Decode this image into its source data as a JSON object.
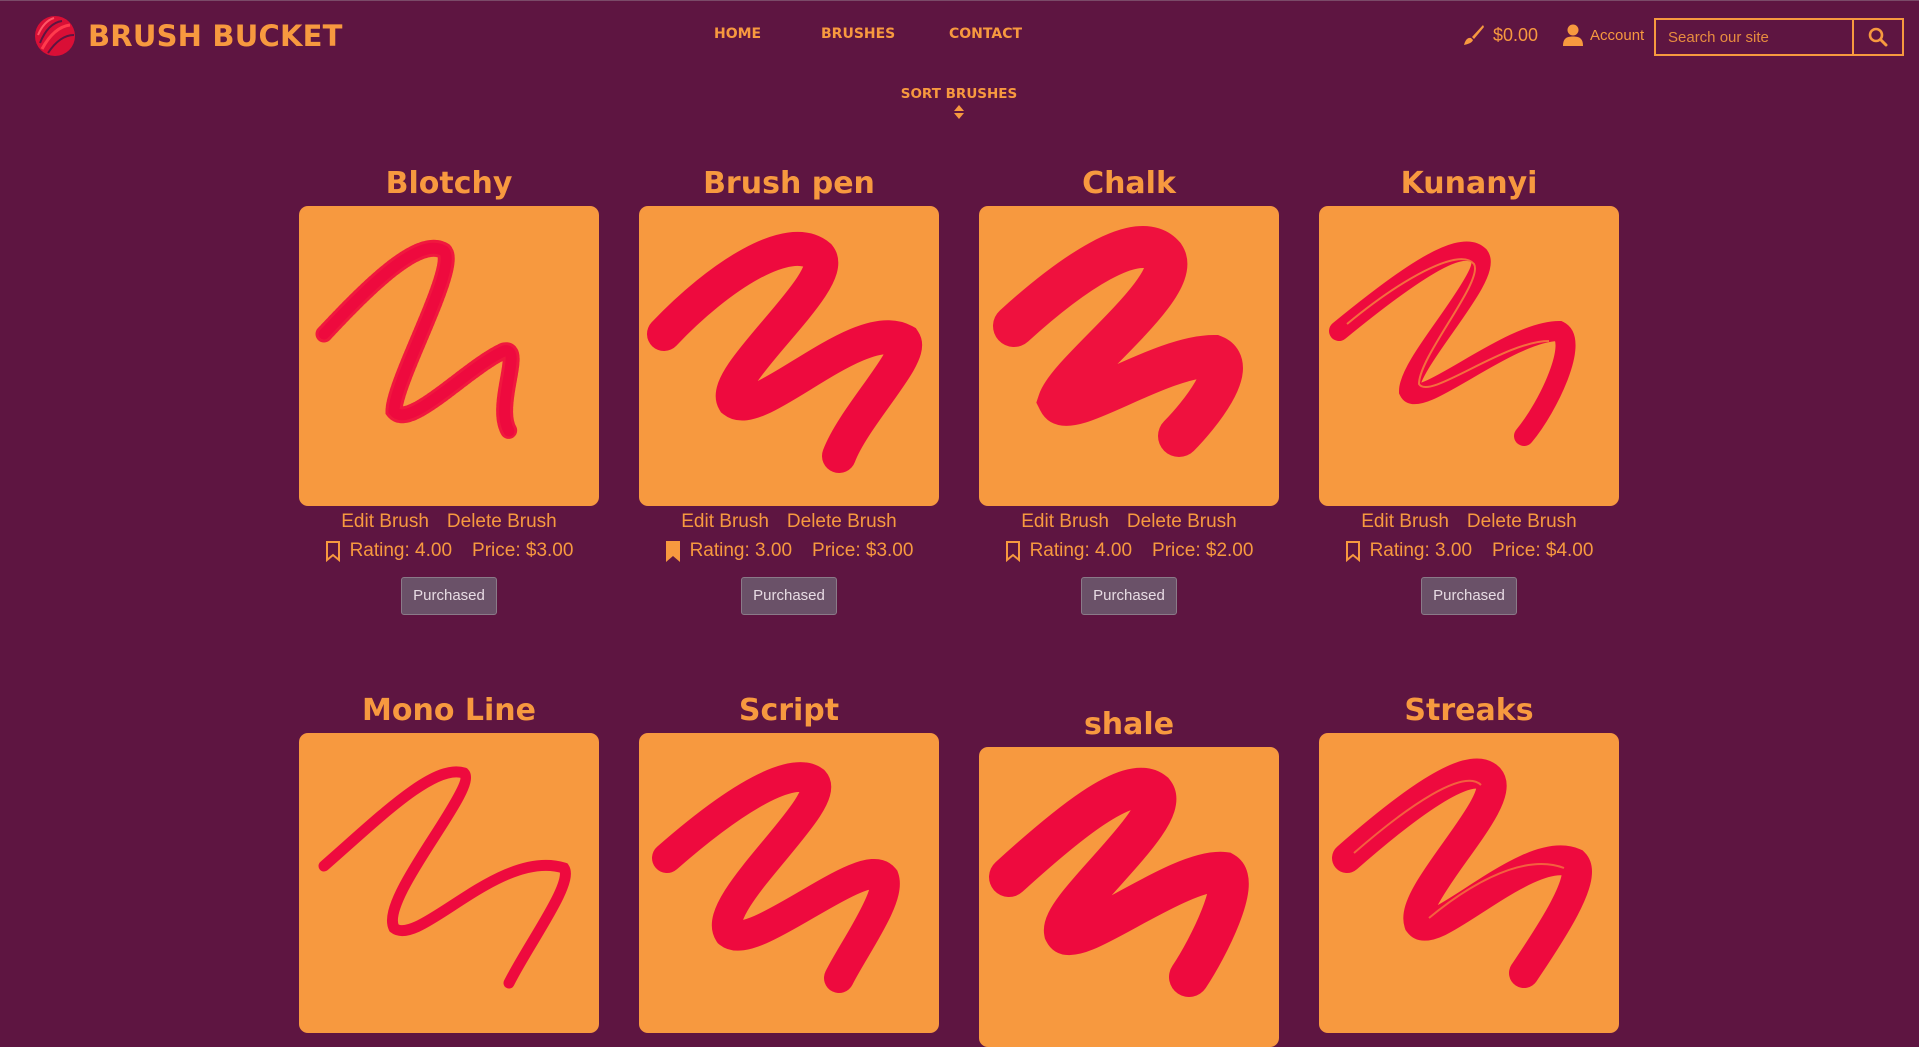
{
  "brand": {
    "name": "BRUSH BUCKET",
    "logo_icon": "paint-blob-logo-icon"
  },
  "nav": {
    "home": "HOME",
    "brushes": "BRUSHES",
    "contact": "CONTACT"
  },
  "cart": {
    "icon": "paint-brush-icon",
    "amount": "$0.00"
  },
  "account": {
    "icon": "user-icon",
    "label": "Account"
  },
  "search": {
    "placeholder": "Search our site",
    "icon": "search-icon"
  },
  "sort": {
    "label": "SORT BRUSHES",
    "icon": "sort-icon"
  },
  "colors": {
    "background": "#5e1541",
    "accent": "#f7993f",
    "stroke": "#ee0a3e"
  },
  "card_actions": {
    "edit": "Edit Brush",
    "delete": "Delete Brush",
    "purchased": "Purchased"
  },
  "brushes": [
    {
      "name": "Blotchy",
      "rating": "Rating: 4.00",
      "price": "Price: $3.00",
      "bookmarked": false
    },
    {
      "name": "Brush pen",
      "rating": "Rating: 3.00",
      "price": "Price: $3.00",
      "bookmarked": true
    },
    {
      "name": "Chalk",
      "rating": "Rating: 4.00",
      "price": "Price: $2.00",
      "bookmarked": false
    },
    {
      "name": "Kunanyi",
      "rating": "Rating: 3.00",
      "price": "Price: $4.00",
      "bookmarked": false
    },
    {
      "name": "Mono Line"
    },
    {
      "name": "Script"
    },
    {
      "name": "shale"
    },
    {
      "name": "Streaks"
    }
  ]
}
